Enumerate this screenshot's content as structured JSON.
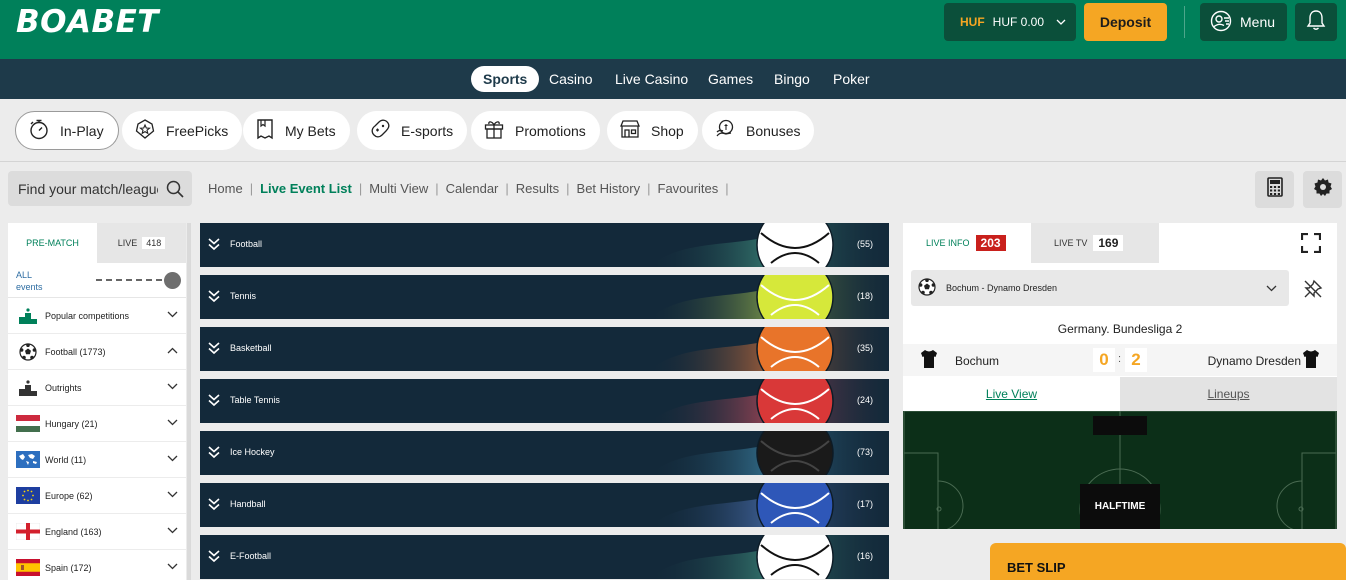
{
  "brand": {
    "logo": "BOABET"
  },
  "header": {
    "currency_code": "HUF",
    "balance": "HUF 0.00",
    "deposit_label": "Deposit",
    "menu_label": "Menu"
  },
  "nav": {
    "items": [
      {
        "label": "Sports",
        "active": true
      },
      {
        "label": "Casino"
      },
      {
        "label": "Live Casino"
      },
      {
        "label": "Games"
      },
      {
        "label": "Bingo"
      },
      {
        "label": "Poker"
      }
    ]
  },
  "quicklinks": [
    {
      "label": "In-Play",
      "icon": "stopwatch-icon",
      "active": true
    },
    {
      "label": "FreePicks",
      "icon": "star-badge-icon"
    },
    {
      "label": "My Bets",
      "icon": "betslip-icon"
    },
    {
      "label": "E-sports",
      "icon": "gamepad-icon"
    },
    {
      "label": "Promotions",
      "icon": "gift-icon"
    },
    {
      "label": "Shop",
      "icon": "shop-icon"
    },
    {
      "label": "Bonuses",
      "icon": "coins-icon"
    }
  ],
  "search": {
    "placeholder": "Find your match/league"
  },
  "breadcrumbs": [
    {
      "label": "Home"
    },
    {
      "label": "Live Event List",
      "active": true
    },
    {
      "label": "Multi View"
    },
    {
      "label": "Calendar"
    },
    {
      "label": "Results"
    },
    {
      "label": "Bet History"
    },
    {
      "label": "Favourites"
    }
  ],
  "sidebar": {
    "tab_prematch": "PRE-MATCH",
    "tab_live": "LIVE",
    "live_count": "418",
    "all_events_line1": "ALL",
    "all_events_line2": "events",
    "items": [
      {
        "label": "Popular competitions",
        "icon": "podium-icon",
        "expanded": false
      },
      {
        "label": "Football (1773)",
        "icon": "football-icon",
        "expanded": true
      },
      {
        "label": "Outrights",
        "icon": "podium-icon",
        "expanded": false
      },
      {
        "label": "Hungary (21)",
        "icon": "flag-hungary-icon",
        "expanded": false
      },
      {
        "label": "World (11)",
        "icon": "flag-world-icon",
        "expanded": false
      },
      {
        "label": "Europe (62)",
        "icon": "flag-europe-icon",
        "expanded": false
      },
      {
        "label": "England (163)",
        "icon": "flag-england-icon",
        "expanded": false
      },
      {
        "label": "Spain (172)",
        "icon": "flag-spain-icon",
        "expanded": false
      }
    ]
  },
  "sports": [
    {
      "name": "Football",
      "count": "(55)",
      "color": "#ffffff"
    },
    {
      "name": "Tennis",
      "count": "(18)",
      "color": "#d6e83a"
    },
    {
      "name": "Basketball",
      "count": "(35)",
      "color": "#e8742a"
    },
    {
      "name": "Table Tennis",
      "count": "(24)",
      "color": "#d93838"
    },
    {
      "name": "Ice Hockey",
      "count": "(73)",
      "color": "#1a1a1a"
    },
    {
      "name": "Handball",
      "count": "(17)",
      "color": "#2e57b8"
    },
    {
      "name": "E-Football",
      "count": "(16)",
      "color": "#ffffff"
    }
  ],
  "live_panel": {
    "tab_info": "LIVE INFO",
    "info_count": "203",
    "tab_tv": "LIVE TV",
    "tv_count": "169",
    "match_select": "Bochum - Dynamo Dresden",
    "league": "Germany. Bundesliga 2",
    "home_team": "Bochum",
    "away_team": "Dynamo Dresden",
    "home_score": "0",
    "away_score": "2",
    "score_separator": ":",
    "view_live": "Live View",
    "view_lineups": "Lineups",
    "status": "HALFTIME"
  },
  "betslip": {
    "label": "BET SLIP"
  },
  "colors": {
    "brand_green": "#00805a",
    "nav_dark": "#1e3a4a",
    "accent_orange": "#f5a623",
    "live_red": "#c9201c"
  }
}
